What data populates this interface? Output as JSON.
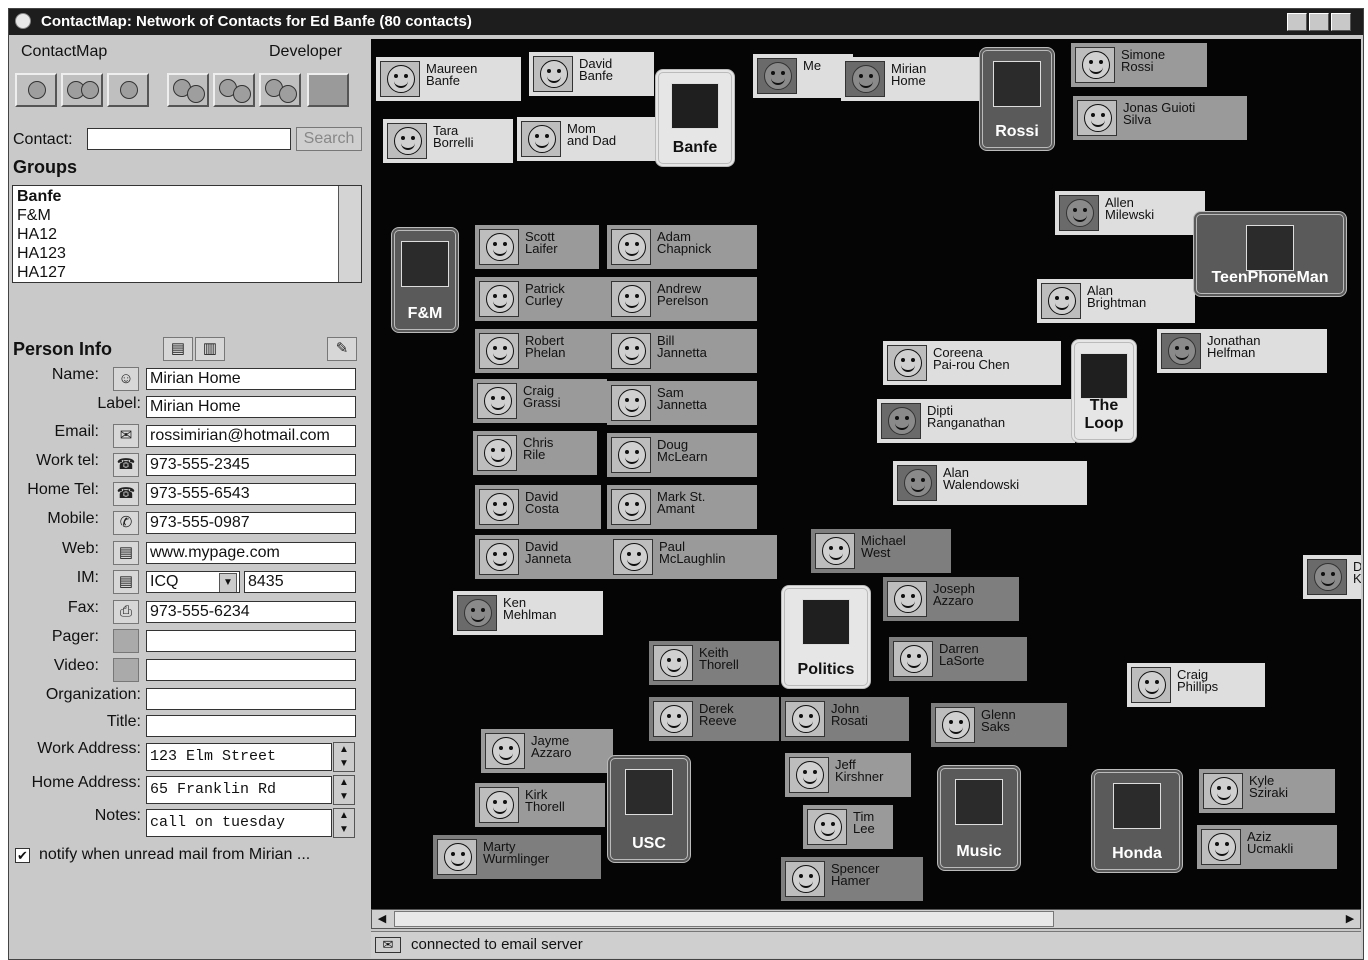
{
  "window": {
    "title": "ContactMap: Network of Contacts for Ed Banfe (80 contacts)"
  },
  "menu": {
    "left": "ContactMap",
    "right": "Developer"
  },
  "toolbar": {
    "buttons": [
      "person-icon",
      "group-people-icon",
      "person-icon",
      "group-many-icon",
      "group-many-icon",
      "group-many-icon",
      "image-icon"
    ]
  },
  "contact": {
    "label": "Contact:",
    "value": "",
    "search_label": "Search"
  },
  "groups": {
    "title": "Groups",
    "items": [
      "Banfe",
      "F&M",
      "HA12",
      "HA123",
      "HA127"
    ]
  },
  "person": {
    "title": "Person Info",
    "name_label": "Name:",
    "name": "Mirian Home",
    "label_label": "Label:",
    "label": "Mirian Home",
    "email_label": "Email:",
    "email": "rossimirian@hotmail.com",
    "work_tel_label": "Work tel:",
    "work_tel": "973-555-2345",
    "home_tel_label": "Home Tel:",
    "home_tel": "973-555-6543",
    "mobile_label": "Mobile:",
    "mobile": "973-555-0987",
    "web_label": "Web:",
    "web": "www.mypage.com",
    "im_label": "IM:",
    "im_service": "ICQ",
    "im_id": "8435",
    "fax_label": "Fax:",
    "fax": "973-555-6234",
    "pager_label": "Pager:",
    "pager": "",
    "video_label": "Video:",
    "video": "",
    "org_label": "Organization:",
    "org": "",
    "title_label": "Title:",
    "title_value": "",
    "work_address_label": "Work Address:",
    "work_address": "123 Elm Street",
    "home_address_label": "Home Address:",
    "home_address": "65 Franklin Rd",
    "notes_label": "Notes:",
    "notes": "call on tuesday",
    "notify_label": "notify when unread mail from Mirian ..."
  },
  "map": {
    "contacts": [
      {
        "n": "Maureen\nBanfe"
      },
      {
        "n": "David\nBanfe"
      },
      {
        "n": "Tara\nBorrelli"
      },
      {
        "n": "Mom\nand Dad"
      },
      {
        "n": "Me"
      },
      {
        "n": "Mirian\nHome"
      },
      {
        "n": "Simone\nRossi"
      },
      {
        "n": "Jonas Guioti\nSilva"
      },
      {
        "n": "Allen\nMilewski"
      },
      {
        "n": "Alan\nBrightman"
      },
      {
        "n": "Jonathan\nHelfman"
      },
      {
        "n": "Scott\nLaifer"
      },
      {
        "n": "Adam\nChapnick"
      },
      {
        "n": "Patrick\nCurley"
      },
      {
        "n": "Andrew\nPerelson"
      },
      {
        "n": "Robert\nPhelan"
      },
      {
        "n": "Bill\nJannetta"
      },
      {
        "n": "Craig\nGrassi"
      },
      {
        "n": "Sam\nJannetta"
      },
      {
        "n": "Chris\nRile"
      },
      {
        "n": "Doug\nMcLearn"
      },
      {
        "n": "David\nCosta"
      },
      {
        "n": "Mark St.\nAmant"
      },
      {
        "n": "David\nJanneta"
      },
      {
        "n": "Paul\nMcLaughlin"
      },
      {
        "n": "Coreena\nPai-rou Chen"
      },
      {
        "n": "Dipti\nRanganathan"
      },
      {
        "n": "Alan\nWalendowski"
      },
      {
        "n": "Michael\nWest"
      },
      {
        "n": "Joseph\nAzzaro"
      },
      {
        "n": "Darren\nLaSorte"
      },
      {
        "n": "Ken\nMehlman"
      },
      {
        "n": "Keith\nThorell"
      },
      {
        "n": "Derek\nReeve"
      },
      {
        "n": "John\nRosati"
      },
      {
        "n": "Glenn\nSaks"
      },
      {
        "n": "Craig\nPhillips"
      },
      {
        "n": "Jayme\nAzzaro"
      },
      {
        "n": "Kirk\nThorell"
      },
      {
        "n": "Jeff\nKirshner"
      },
      {
        "n": "Tim\nLee"
      },
      {
        "n": "Marty\nWurmlinger"
      },
      {
        "n": "Spencer\nHamer"
      },
      {
        "n": "Kyle\nSziraki"
      },
      {
        "n": "Aziz\nUcmakli"
      },
      {
        "n": "D\nK"
      }
    ],
    "groups": [
      "Banfe",
      "Rossi",
      "F&M",
      "TeenPhoneMan",
      "The\nLoop",
      "Politics",
      "USC",
      "Music",
      "Honda"
    ]
  },
  "status": {
    "text": "connected to email server"
  }
}
